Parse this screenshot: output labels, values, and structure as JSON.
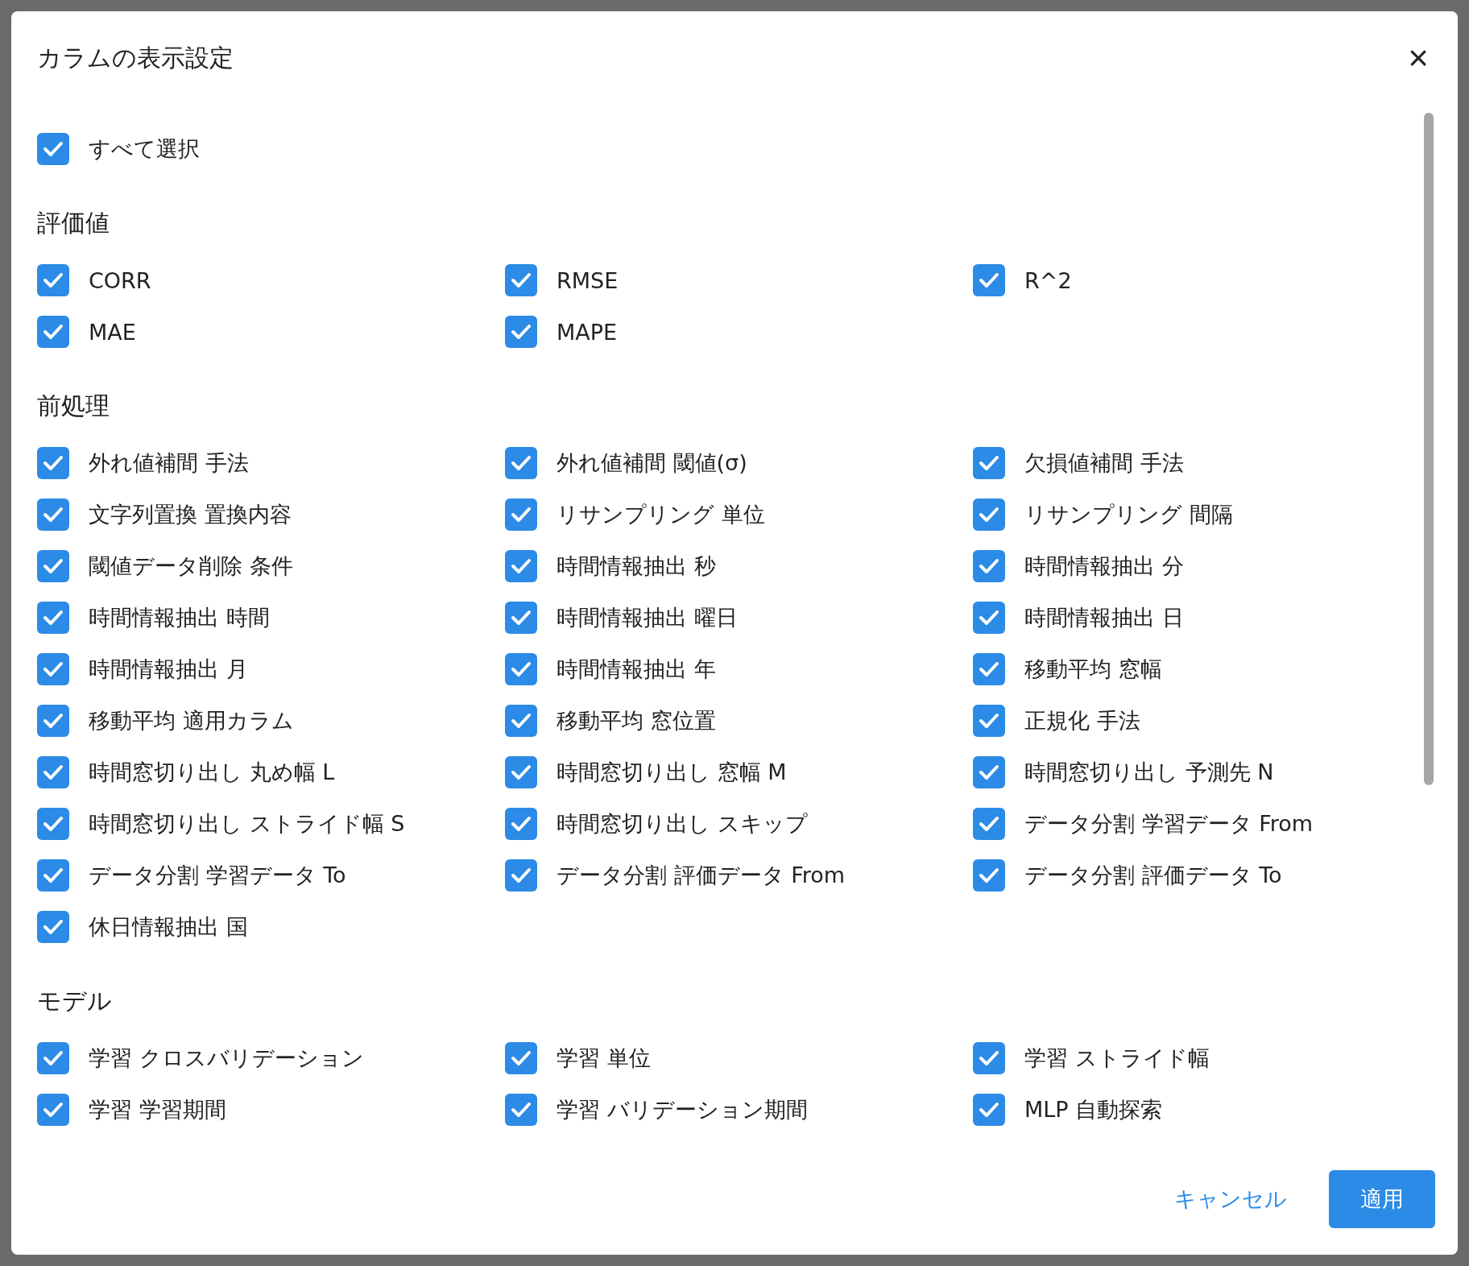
{
  "dialog": {
    "title": "カラムの表示設定",
    "close_label": "×"
  },
  "select_all": {
    "label": "すべて選択",
    "checked": true
  },
  "sections": [
    {
      "heading": "評価値",
      "items": [
        {
          "label": "CORR",
          "checked": true
        },
        {
          "label": "RMSE",
          "checked": true
        },
        {
          "label": "R^2",
          "checked": true
        },
        {
          "label": "MAE",
          "checked": true
        },
        {
          "label": "MAPE",
          "checked": true
        }
      ]
    },
    {
      "heading": "前処理",
      "items": [
        {
          "label": "外れ値補間 手法",
          "checked": true
        },
        {
          "label": "外れ値補間 閾値(σ)",
          "checked": true
        },
        {
          "label": "欠損値補間 手法",
          "checked": true
        },
        {
          "label": "文字列置換 置換内容",
          "checked": true
        },
        {
          "label": "リサンプリング 単位",
          "checked": true
        },
        {
          "label": "リサンプリング 間隔",
          "checked": true
        },
        {
          "label": "閾値データ削除 条件",
          "checked": true
        },
        {
          "label": "時間情報抽出 秒",
          "checked": true
        },
        {
          "label": "時間情報抽出 分",
          "checked": true
        },
        {
          "label": "時間情報抽出 時間",
          "checked": true
        },
        {
          "label": "時間情報抽出 曜日",
          "checked": true
        },
        {
          "label": "時間情報抽出 日",
          "checked": true
        },
        {
          "label": "時間情報抽出 月",
          "checked": true
        },
        {
          "label": "時間情報抽出 年",
          "checked": true
        },
        {
          "label": "移動平均 窓幅",
          "checked": true
        },
        {
          "label": "移動平均 適用カラム",
          "checked": true
        },
        {
          "label": "移動平均 窓位置",
          "checked": true
        },
        {
          "label": "正規化 手法",
          "checked": true
        },
        {
          "label": "時間窓切り出し 丸め幅 L",
          "checked": true
        },
        {
          "label": "時間窓切り出し 窓幅 M",
          "checked": true
        },
        {
          "label": "時間窓切り出し 予測先 N",
          "checked": true
        },
        {
          "label": "時間窓切り出し ストライド幅 S",
          "checked": true
        },
        {
          "label": "時間窓切り出し スキップ",
          "checked": true
        },
        {
          "label": "データ分割 学習データ From",
          "checked": true
        },
        {
          "label": "データ分割 学習データ To",
          "checked": true
        },
        {
          "label": "データ分割 評価データ From",
          "checked": true
        },
        {
          "label": "データ分割 評価データ To",
          "checked": true
        },
        {
          "label": "休日情報抽出 国",
          "checked": true
        }
      ]
    },
    {
      "heading": "モデル",
      "items": [
        {
          "label": "学習 クロスバリデーション",
          "checked": true
        },
        {
          "label": "学習 単位",
          "checked": true
        },
        {
          "label": "学習 ストライド幅",
          "checked": true
        },
        {
          "label": "学習 学習期間",
          "checked": true
        },
        {
          "label": "学習 バリデーション期間",
          "checked": true
        },
        {
          "label": "MLP 自動探索",
          "checked": true
        }
      ]
    }
  ],
  "footer": {
    "cancel": "キャンセル",
    "apply": "適用"
  }
}
